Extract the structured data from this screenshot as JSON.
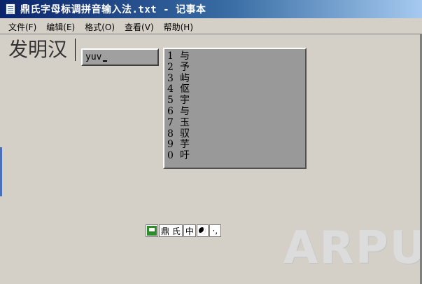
{
  "window": {
    "title": "鼎氏字母标调拼音输入法.txt - 记事本",
    "icon": "notepad-icon"
  },
  "menu": [
    {
      "label": "文件(F)"
    },
    {
      "label": "编辑(E)"
    },
    {
      "label": "格式(O)"
    },
    {
      "label": "查看(V)"
    },
    {
      "label": "帮助(H)"
    }
  ],
  "editor": {
    "text": "发明汉"
  },
  "ime": {
    "composition": "yuv",
    "candidates": [
      {
        "num": "1",
        "char": "与"
      },
      {
        "num": "2",
        "char": "予"
      },
      {
        "num": "3",
        "char": "屿"
      },
      {
        "num": "4",
        "char": "伛"
      },
      {
        "num": "5",
        "char": "宇"
      },
      {
        "num": "6",
        "char": "与"
      },
      {
        "num": "7",
        "char": "玉"
      },
      {
        "num": "8",
        "char": "驭"
      },
      {
        "num": "9",
        "char": "芋"
      },
      {
        "num": "0",
        "char": "吁"
      }
    ],
    "status": {
      "logo_icon": "ime-logo-icon",
      "name": "鼎 氏",
      "mode": "中",
      "width_icon": "moon-icon",
      "punct": "·,"
    }
  },
  "watermark": "ARPUN"
}
